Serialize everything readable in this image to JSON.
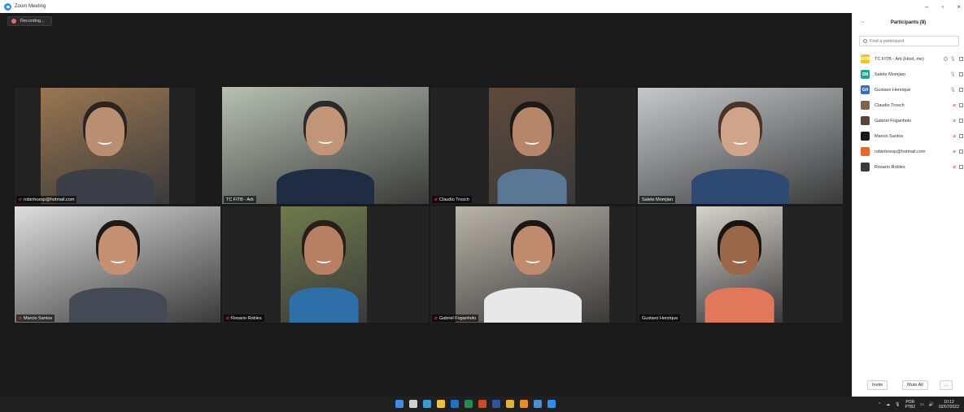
{
  "window": {
    "title": "Zoom Meeting",
    "controls": [
      "–",
      "▫",
      "×"
    ]
  },
  "meeting": {
    "recording_label": "Recording...",
    "tiles": [
      {
        "name": "robinhoesp@hotmail.com",
        "muted": true,
        "active": false,
        "skin": "#b98f70",
        "hair": "#2b2420",
        "shirt": "#3c3f48",
        "bg": "#9a7650"
      },
      {
        "name": "TC FITB - Arti",
        "muted": false,
        "active": true,
        "skin": "#c29577",
        "hair": "#2a2a2a",
        "shirt": "#1e2c44",
        "bg": "#b7c0b2"
      },
      {
        "name": "Claudio Trosch",
        "muted": true,
        "active": false,
        "skin": "#b58768",
        "hair": "#1c1a18",
        "shirt": "#5a7896",
        "bg": "#5e4a3a"
      },
      {
        "name": "Salete Momjian",
        "muted": false,
        "active": false,
        "skin": "#d0a488",
        "hair": "#4a3427",
        "shirt": "#2f4a72",
        "bg": "#c5c8cc"
      },
      {
        "name": "Marcio Santos",
        "muted": true,
        "active": false,
        "skin": "#c69172",
        "hair": "#201a17",
        "shirt": "#444a55",
        "bg": "#dedede"
      },
      {
        "name": "Rosario Robles",
        "muted": true,
        "active": false,
        "skin": "#b88063",
        "hair": "#2a1d16",
        "shirt": "#2f6fa8",
        "bg": "#6e7a4c"
      },
      {
        "name": "Gabriel Foganholo",
        "muted": true,
        "active": false,
        "skin": "#c08a6c",
        "hair": "#1b1614",
        "shirt": "#e8e8e8",
        "bg": "#b9b4a8"
      },
      {
        "name": "Gustavo Henrique",
        "muted": false,
        "active": false,
        "skin": "#9a6749",
        "hair": "#1a1411",
        "shirt": "#e1785c",
        "bg": "#d6d2cc"
      }
    ]
  },
  "participants": {
    "title": "Participants (8)",
    "search_placeholder": "Find a participant",
    "items": [
      {
        "initials": "FITB",
        "name": "TC FITB - Arti (Host, me)",
        "avatar_color": "#f2c417",
        "muted": false
      },
      {
        "initials": "SM",
        "name": "Salete Momjian",
        "avatar_color": "#1fa58c",
        "muted": false
      },
      {
        "initials": "GH",
        "name": "Gustavo Henrique",
        "avatar_color": "#2e6fd1",
        "muted": false
      },
      {
        "initials": "",
        "name": "Claudio Trosch",
        "avatar_color": "#7d6553",
        "muted": true
      },
      {
        "initials": "",
        "name": "Gabriel Foganholo",
        "avatar_color": "#5a4535",
        "muted": true
      },
      {
        "initials": "",
        "name": "Marcio Santos",
        "avatar_color": "#1a1a1a",
        "muted": true
      },
      {
        "initials": "",
        "name": "robinhoesp@hotmail.com",
        "avatar_color": "#e8682a",
        "muted": true
      },
      {
        "initials": "",
        "name": "Rosario Robles",
        "avatar_color": "#3a3a3a",
        "muted": true
      }
    ],
    "invite_label": "Invite",
    "mute_all_label": "Mute All",
    "more_label": "..."
  },
  "taskbar": {
    "apps": [
      "start-icon",
      "search-icon",
      "edge-icon",
      "explorer-icon",
      "outlook-icon",
      "excel-icon",
      "powerpoint-icon",
      "word-icon",
      "chrome-icon",
      "vlc-icon",
      "tasks-icon",
      "zoom-icon"
    ],
    "app_colors": [
      "#3b8ee8",
      "#d0d0d0",
      "#2fa0d8",
      "#f1c232",
      "#1a73c8",
      "#1e8e4e",
      "#d24726",
      "#2b579a",
      "#e6b12e",
      "#f08a1d",
      "#4a90d9",
      "#2d8cff"
    ],
    "lang_top": "POR",
    "lang_bottom": "PTB2",
    "time": "10:12",
    "date": "02/07/2022"
  }
}
